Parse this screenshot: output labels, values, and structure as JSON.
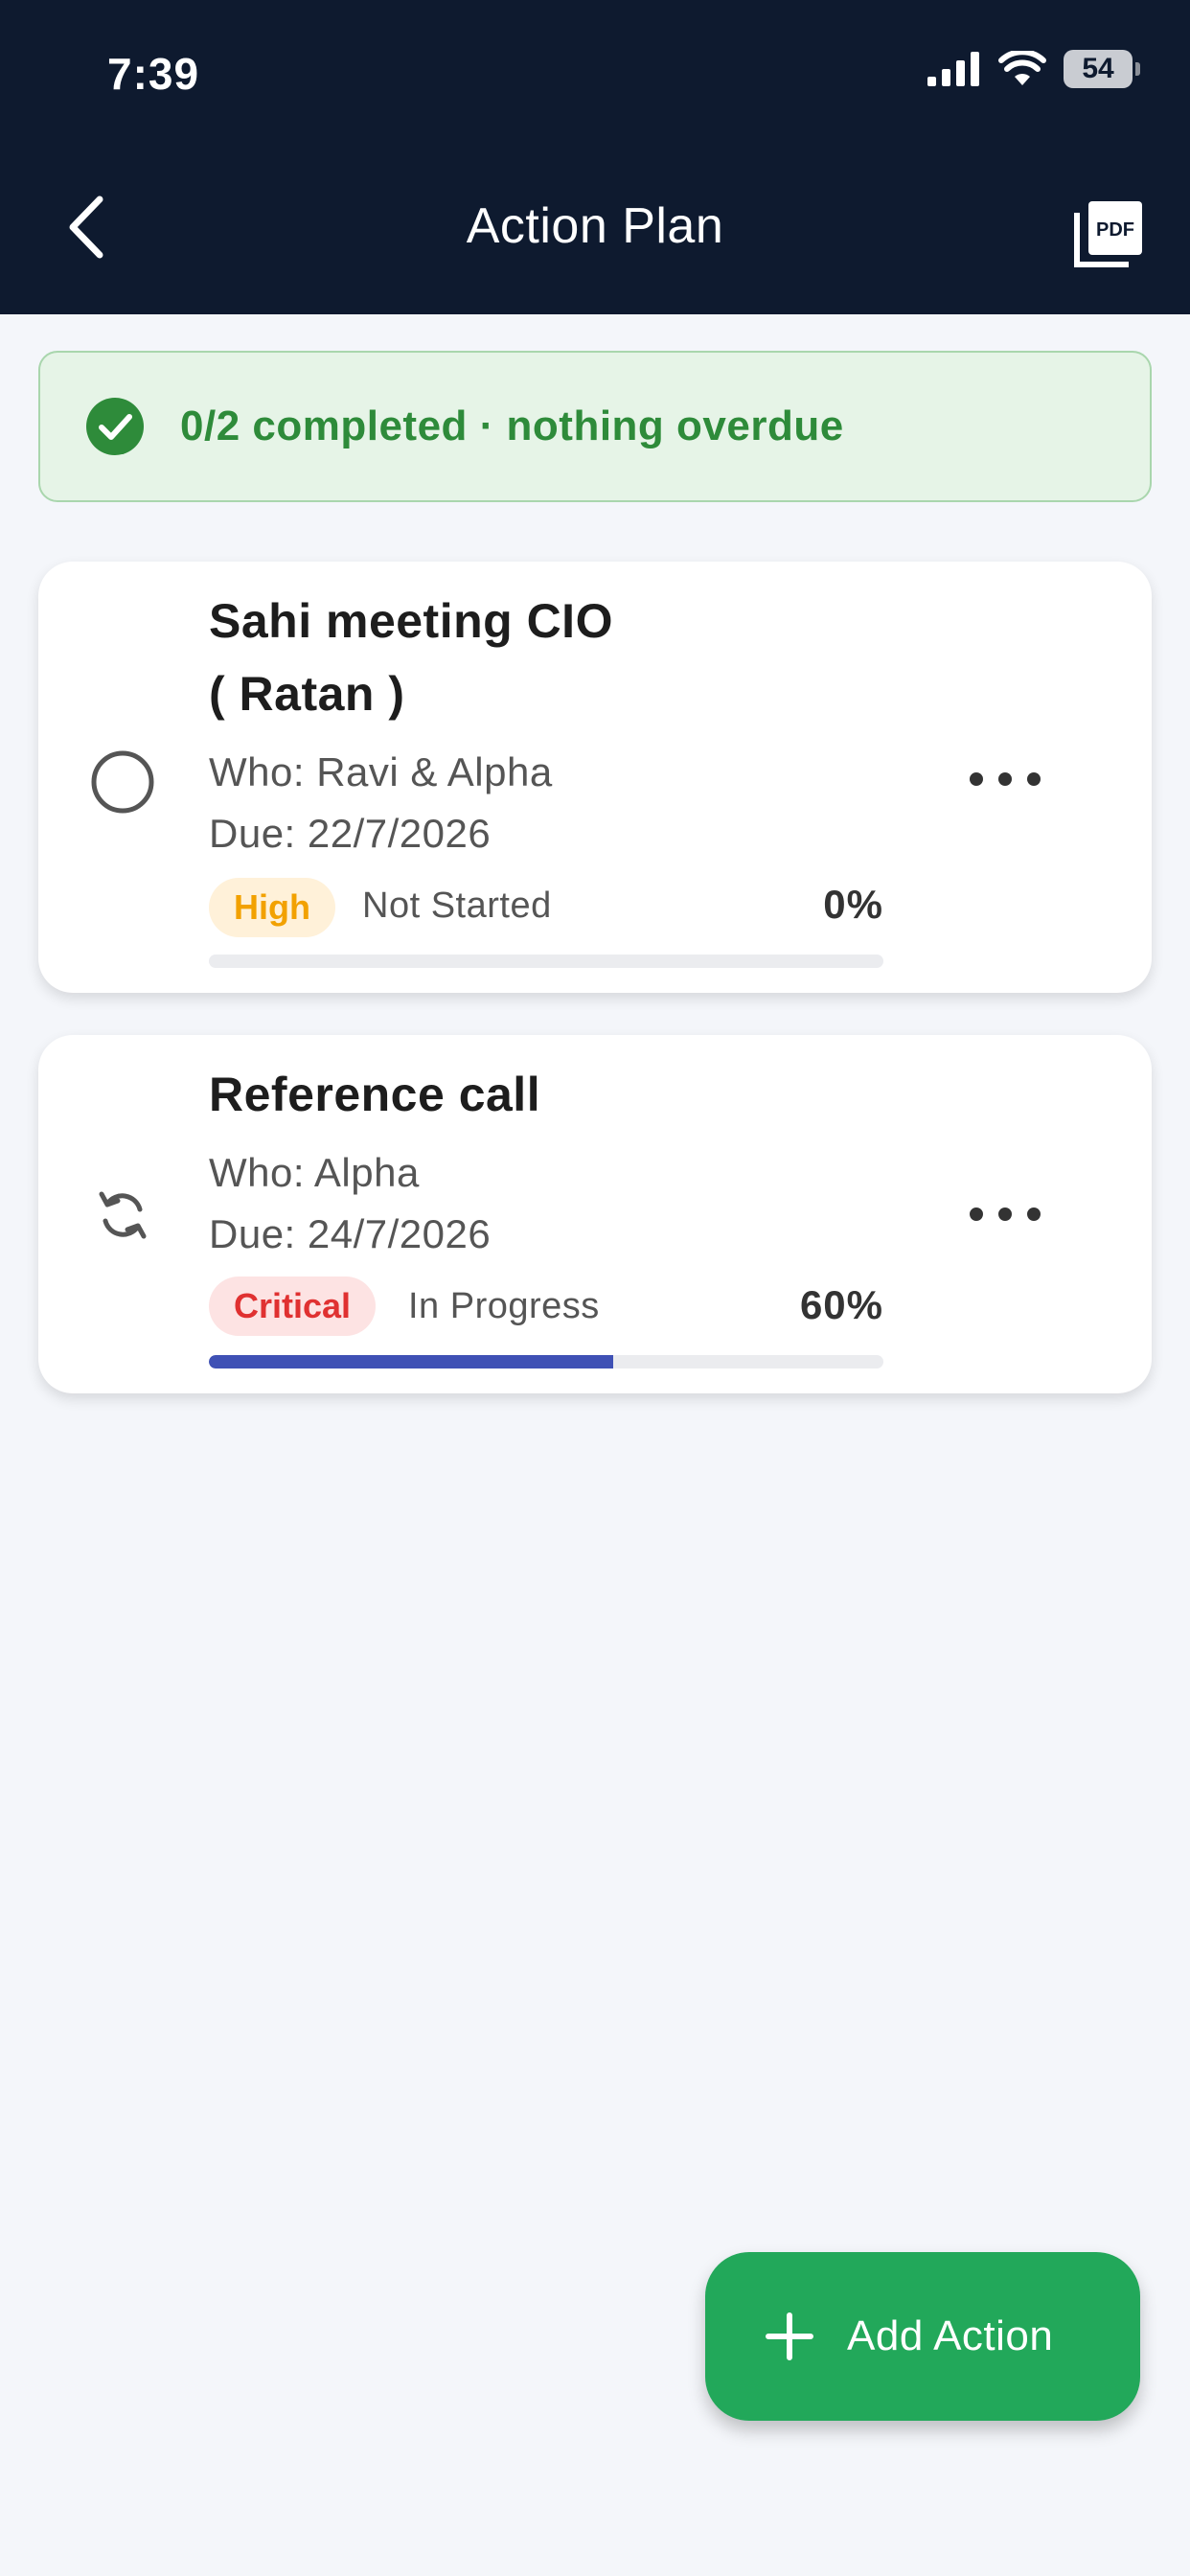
{
  "status_bar": {
    "time": "7:39",
    "battery": "54"
  },
  "header": {
    "title": "Action Plan",
    "back_icon": "chevron-left-icon",
    "export_icon": "pdf-icon"
  },
  "summary": {
    "text": "0/2 completed · nothing overdue",
    "icon": "check-circle-icon",
    "color": "#2e8b3a"
  },
  "actions": [
    {
      "title_line1": "Sahi meeting CIO",
      "title_line2": "( Ratan )",
      "who": "Who: Ravi & Alpha",
      "due": "Due: 22/7/2026",
      "priority": "High",
      "status": "Not Started",
      "progress_label": "0%",
      "progress": 0,
      "status_icon": "empty-circle-icon"
    },
    {
      "title_line1": "Reference call",
      "who": "Who: Alpha",
      "due": "Due: 24/7/2026",
      "priority": "Critical",
      "status": "In Progress",
      "progress_label": "60%",
      "progress": 0.6,
      "status_icon": "sync-icon"
    }
  ],
  "fab": {
    "label": "Add Action",
    "icon": "plus-icon",
    "color": "#22a85a"
  },
  "colors": {
    "header_bg": "#0e1a2f",
    "progress_fill": "#3f51b5",
    "high": "#f2a100",
    "critical": "#e03131"
  }
}
